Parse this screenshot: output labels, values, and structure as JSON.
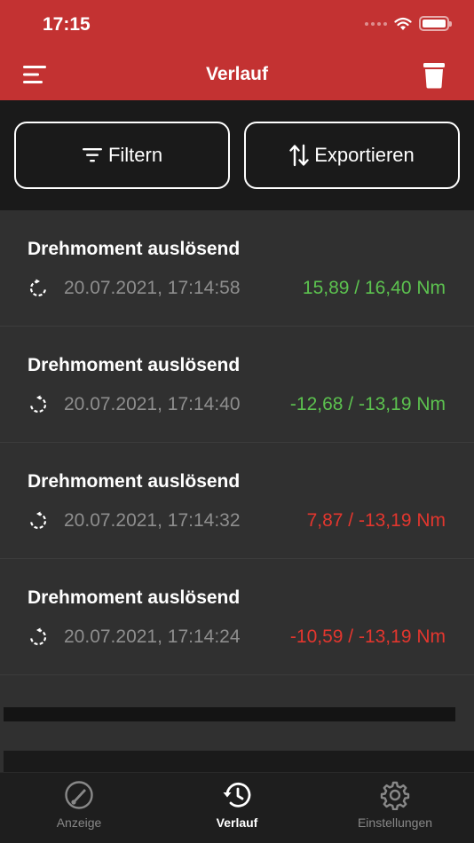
{
  "status_bar": {
    "time": "17:15"
  },
  "nav": {
    "title": "Verlauf",
    "menu_icon": "menu-icon",
    "trash_icon": "trash-icon"
  },
  "toolbar": {
    "filter_label": "Filtern",
    "export_label": "Exportieren"
  },
  "history": [
    {
      "title": "Drehmoment auslösend",
      "timestamp": "20.07.2021, 17:14:58",
      "value": "15,89 / 16,40 Nm",
      "status": "green",
      "direction": "clockwise"
    },
    {
      "title": "Drehmoment auslösend",
      "timestamp": "20.07.2021, 17:14:40",
      "value": "-12,68 / -13,19 Nm",
      "status": "green",
      "direction": "counterclockwise"
    },
    {
      "title": "Drehmoment auslösend",
      "timestamp": "20.07.2021, 17:14:32",
      "value": "7,87 / -13,19 Nm",
      "status": "red",
      "direction": "counterclockwise"
    },
    {
      "title": "Drehmoment auslösend",
      "timestamp": "20.07.2021, 17:14:24",
      "value": "-10,59 / -13,19 Nm",
      "status": "red",
      "direction": "counterclockwise"
    }
  ],
  "tabs": [
    {
      "label": "Anzeige",
      "icon": "gauge-icon",
      "active": false
    },
    {
      "label": "Verlauf",
      "icon": "history-icon",
      "active": true
    },
    {
      "label": "Einstellungen",
      "icon": "gear-icon",
      "active": false
    }
  ],
  "colors": {
    "header": "#c33232",
    "green": "#5cc24f",
    "red": "#e3362e"
  }
}
